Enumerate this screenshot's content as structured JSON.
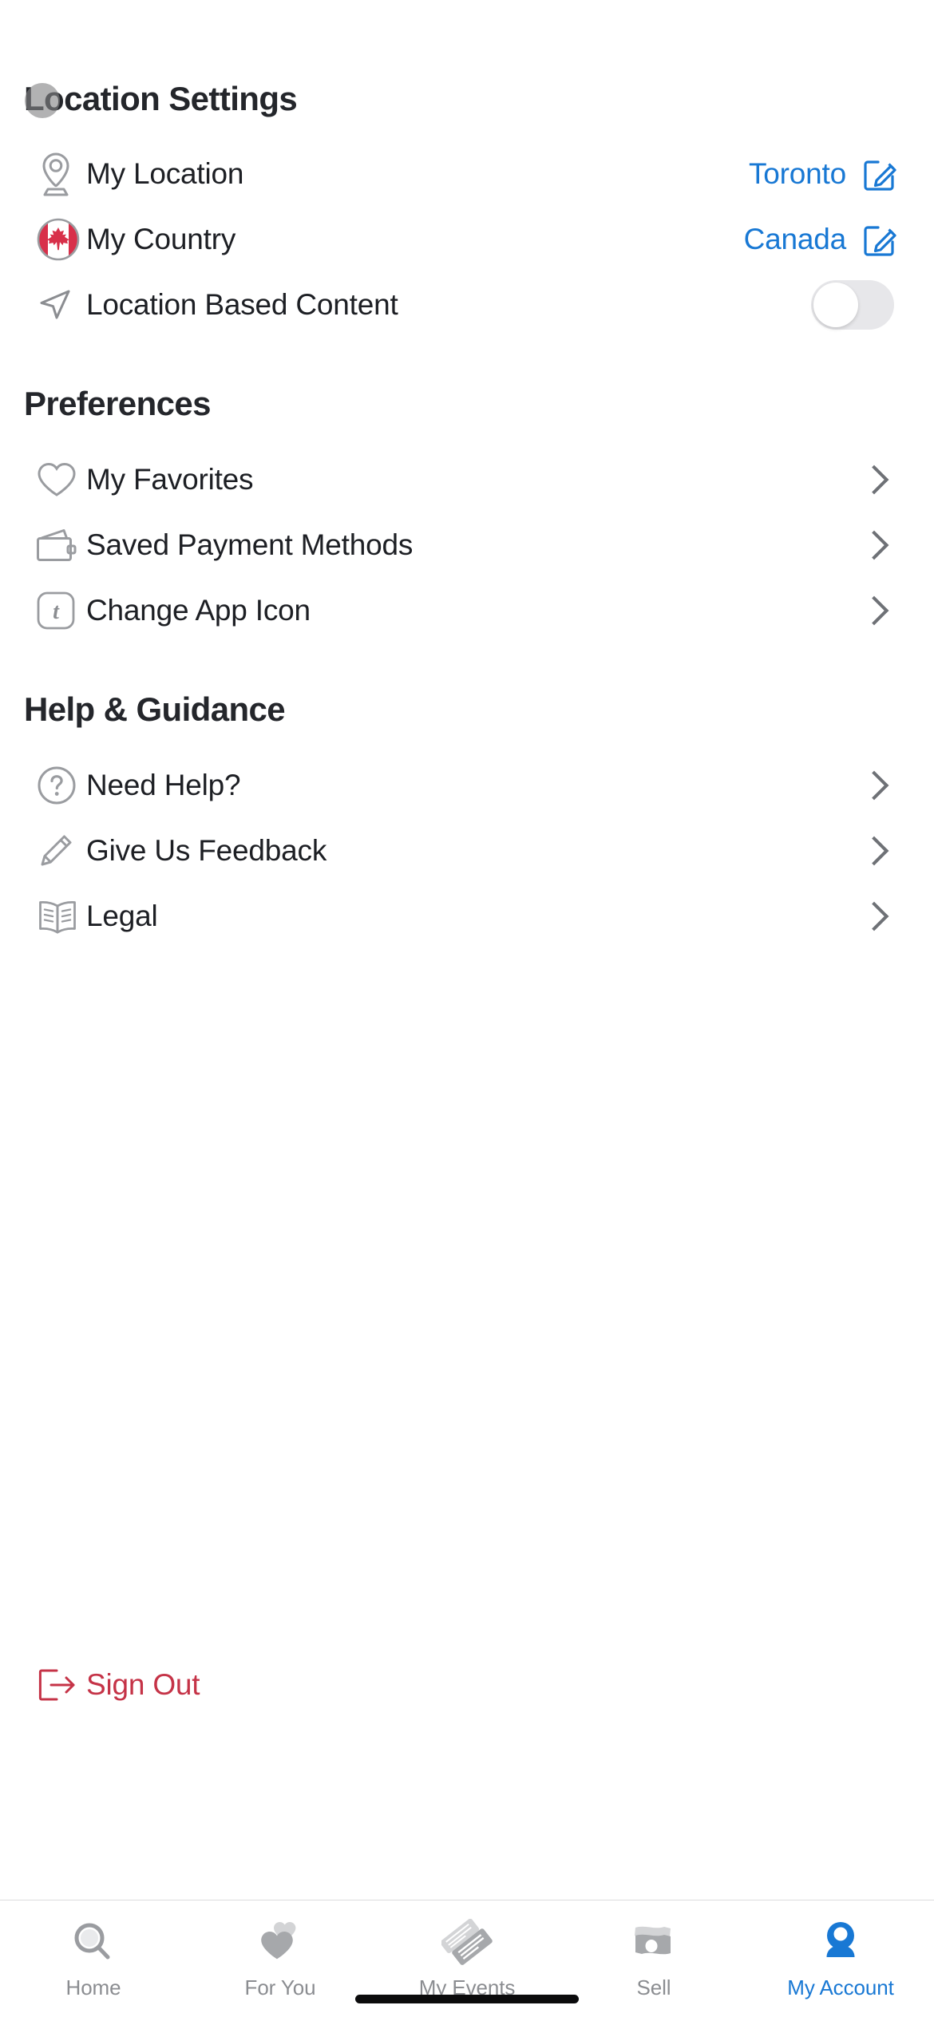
{
  "sections": [
    {
      "id": "location",
      "title": "Location Settings"
    },
    {
      "id": "preferences",
      "title": "Preferences"
    },
    {
      "id": "help",
      "title": "Help & Guidance"
    }
  ],
  "location_rows": [
    {
      "icon": "map-pin-icon",
      "label": "My Location",
      "value": "Toronto",
      "action": "edit"
    },
    {
      "icon": "canada-flag-icon",
      "label": "My Country",
      "value": "Canada",
      "action": "edit"
    },
    {
      "icon": "navigation-arrow-icon",
      "label": "Location Based Content",
      "toggle": "off"
    }
  ],
  "preference_rows": [
    {
      "icon": "heart-icon",
      "label": "My Favorites",
      "action": "chevron"
    },
    {
      "icon": "wallet-icon",
      "label": "Saved Payment Methods",
      "action": "chevron"
    },
    {
      "icon": "app-icon-tile",
      "label": "Change App Icon",
      "action": "chevron",
      "glyph": "t"
    }
  ],
  "help_rows": [
    {
      "icon": "question-circle-icon",
      "label": "Need Help?",
      "action": "chevron"
    },
    {
      "icon": "pencil-icon",
      "label": "Give Us Feedback",
      "action": "chevron"
    },
    {
      "icon": "open-book-icon",
      "label": "Legal",
      "action": "chevron"
    }
  ],
  "sign_out": {
    "icon": "sign-out-icon",
    "label": "Sign Out"
  },
  "tabs": [
    {
      "icon": "search-icon",
      "label": "Home",
      "active": false
    },
    {
      "icon": "hearts-icon",
      "label": "For You",
      "active": false
    },
    {
      "icon": "tickets-icon",
      "label": "My Events",
      "active": false
    },
    {
      "icon": "money-icon",
      "label": "Sell",
      "active": false
    },
    {
      "icon": "person-icon",
      "label": "My Account",
      "active": true
    }
  ],
  "colors": {
    "accent_blue": "#1878d4",
    "danger_red": "#c53347",
    "text_primary": "#1d1f24",
    "icon_gray": "#8b8d91",
    "toggle_track_off": "#e7e7ea"
  }
}
